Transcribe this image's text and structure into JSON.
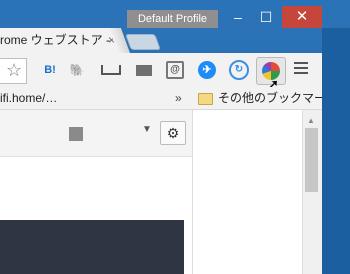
{
  "window": {
    "profile_badge": "Default Profile",
    "minimize": "–",
    "maximize": "☐",
    "close": "✕"
  },
  "tab": {
    "title": "rome ウェブストア -",
    "close": "×"
  },
  "toolbar": {
    "star": "☆",
    "hatena_label": "B!",
    "evernote_label": "🐘",
    "atmail_label": "@",
    "messenger_label": "✈",
    "sync_label": "↻",
    "icons": [
      "star-icon",
      "hatena-bookmark-icon",
      "evernote-icon",
      "keyboard-icon",
      "mail-icon",
      "at-mail-icon",
      "messenger-icon",
      "sync-icon",
      "pie-chart-icon",
      "menu-icon"
    ]
  },
  "bookmarks": {
    "url_fragment": "ifi.home/…",
    "chevron": "»",
    "other": "その他のブックマーク"
  },
  "page": {
    "gear": "⚙",
    "dropdown": "▼",
    "scroll_up": "▲"
  },
  "colors": {
    "frame": "#2a6fb2",
    "close_button": "#c7463b",
    "profile_badge": "#8f8f8f"
  }
}
